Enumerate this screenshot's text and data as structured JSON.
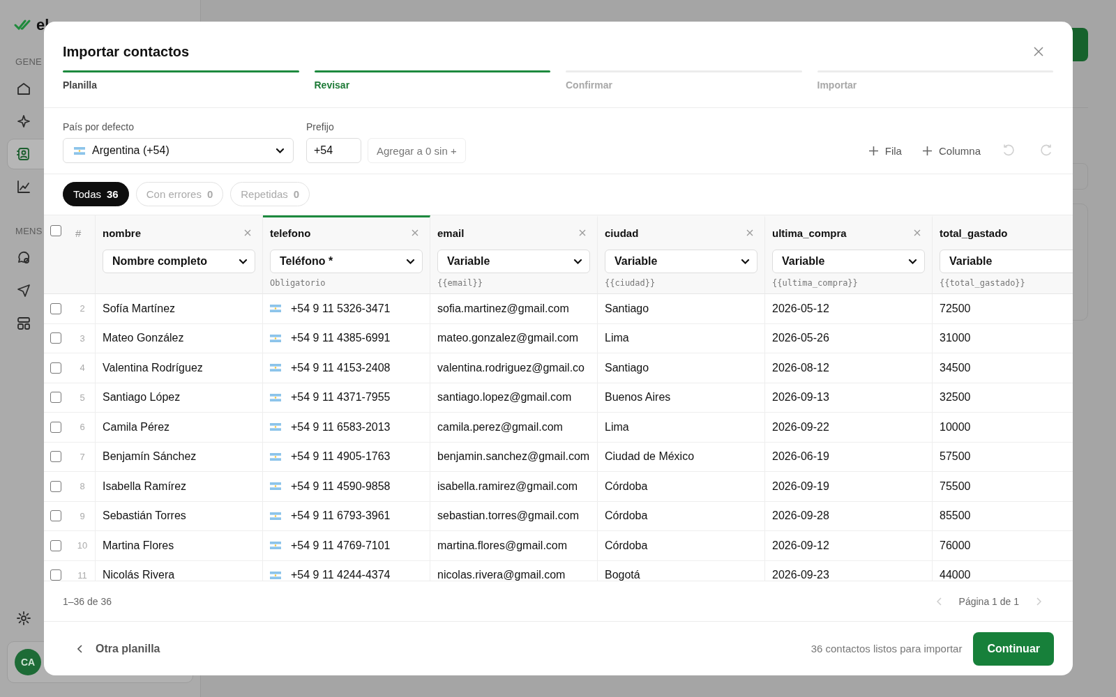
{
  "sidebar": {
    "logo": "el",
    "sections": [
      {
        "label": "GENE",
        "items": [
          {
            "selected": false
          },
          {
            "selected": false
          },
          {
            "selected": true
          },
          {
            "selected": false
          }
        ]
      },
      {
        "label": "MENS",
        "items": [
          {
            "selected": false
          },
          {
            "selected": false
          },
          {
            "selected": false
          }
        ]
      }
    ],
    "user": {
      "initials": "CA"
    }
  },
  "modal": {
    "title": "Importar contactos",
    "steps": [
      {
        "label": "Planilla",
        "completed": true,
        "selected": false
      },
      {
        "label": "Revisar",
        "completed": false,
        "selected": true
      },
      {
        "label": "Confirmar",
        "completed": false,
        "selected": false
      },
      {
        "label": "Importar",
        "completed": false,
        "selected": false
      }
    ]
  },
  "country": {
    "label": "País por defecto",
    "value": "Argentina (+54)"
  },
  "prefix": {
    "label": "Prefijo",
    "value": "+54",
    "button": "Agregar a 0 sin +"
  },
  "actions": [
    {
      "label": "Fila"
    },
    {
      "label": "Columna"
    }
  ],
  "undo": {
    "disabled": true
  },
  "redo": {
    "disabled": true
  },
  "filters": [
    {
      "label": "Todas",
      "count": "36",
      "selected": true
    },
    {
      "label": "Con errores",
      "count": "0",
      "selected": false
    },
    {
      "label": "Repetidas",
      "count": "0",
      "selected": false
    }
  ],
  "table": {
    "all_checked": false,
    "number_heading": "#",
    "columns": [
      {
        "name": "nombre",
        "mapping": "Nombre completo",
        "selected": false,
        "removable": true
      },
      {
        "name": "telefono",
        "mapping": "Teléfono *",
        "hint": "Obligatorio",
        "selected": true,
        "removable": true
      },
      {
        "name": "email",
        "mapping": "Variable",
        "hint": "{{email}}",
        "selected": false,
        "removable": true
      },
      {
        "name": "ciudad",
        "mapping": "Variable",
        "hint": "{{ciudad}}",
        "selected": false,
        "removable": true
      },
      {
        "name": "ultima_compra",
        "mapping": "Variable",
        "hint": "{{ultima_compra}}",
        "selected": false,
        "removable": true
      },
      {
        "name": "total_gastado",
        "mapping": "Variable",
        "hint": "{{total_gastado}}",
        "selected": false,
        "removable": false
      }
    ],
    "rows": [
      {
        "number": "2",
        "checked": false,
        "cells": [
          "Sofía Martínez",
          "+54 9 11 5326-3471",
          "sofia.martinez@gmail.com",
          "Santiago",
          "2026-05-12",
          "72500"
        ]
      },
      {
        "number": "3",
        "checked": false,
        "cells": [
          "Mateo González",
          "+54 9 11 4385-6991",
          "mateo.gonzalez@gmail.com",
          "Lima",
          "2026-05-26",
          "31000"
        ]
      },
      {
        "number": "4",
        "checked": false,
        "cells": [
          "Valentina Rodríguez",
          "+54 9 11 4153-2408",
          "valentina.rodriguez@gmail.co",
          "Santiago",
          "2026-08-12",
          "34500"
        ]
      },
      {
        "number": "5",
        "checked": false,
        "cells": [
          "Santiago López",
          "+54 9 11 4371-7955",
          "santiago.lopez@gmail.com",
          "Buenos Aires",
          "2026-09-13",
          "32500"
        ]
      },
      {
        "number": "6",
        "checked": false,
        "cells": [
          "Camila Pérez",
          "+54 9 11 6583-2013",
          "camila.perez@gmail.com",
          "Lima",
          "2026-09-22",
          "10000"
        ]
      },
      {
        "number": "7",
        "checked": false,
        "cells": [
          "Benjamín Sánchez",
          "+54 9 11 4905-1763",
          "benjamin.sanchez@gmail.com",
          "Ciudad de México",
          "2026-06-19",
          "57500"
        ]
      },
      {
        "number": "8",
        "checked": false,
        "cells": [
          "Isabella Ramírez",
          "+54 9 11 4590-9858",
          "isabella.ramirez@gmail.com",
          "Córdoba",
          "2026-09-19",
          "75500"
        ]
      },
      {
        "number": "9",
        "checked": false,
        "cells": [
          "Sebastián Torres",
          "+54 9 11 6793-3961",
          "sebastian.torres@gmail.com",
          "Córdoba",
          "2026-09-28",
          "85500"
        ]
      },
      {
        "number": "10",
        "checked": false,
        "cells": [
          "Martina Flores",
          "+54 9 11 4769-7101",
          "martina.flores@gmail.com",
          "Córdoba",
          "2026-09-12",
          "76000"
        ]
      },
      {
        "number": "11",
        "checked": false,
        "cells": [
          "Nicolás Rivera",
          "+54 9 11 4244-4374",
          "nicolas.rivera@gmail.com",
          "Bogotá",
          "2026-09-23",
          "44000"
        ]
      }
    ]
  },
  "pagination": {
    "range": "1–36 de 36",
    "page": "Página 1 de 1",
    "prev_disabled": true,
    "next_disabled": true
  },
  "footer": {
    "back": "Otra planilla",
    "summary": "36 contactos listos para importar",
    "continue": "Continuar"
  }
}
